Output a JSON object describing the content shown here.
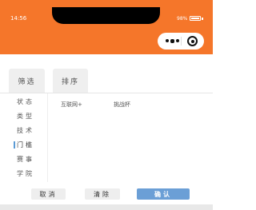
{
  "status": {
    "time": "14:56",
    "battery": "98%"
  },
  "tabs": {
    "filter": "筛选",
    "sort": "排序"
  },
  "categories": [
    "状态",
    "类型",
    "技术",
    "门槛",
    "赛事",
    "学院"
  ],
  "options": [
    "互联网+",
    "挑战杯"
  ],
  "buttons": {
    "cancel": "取消",
    "clear": "清除",
    "confirm": "确认"
  },
  "colors": {
    "header": "#f5762a",
    "confirm": "#6b9fd6",
    "active_indicator": "#5b9bd5"
  },
  "icons": {
    "menu": "more-dots-icon",
    "close": "target-circle-icon"
  }
}
